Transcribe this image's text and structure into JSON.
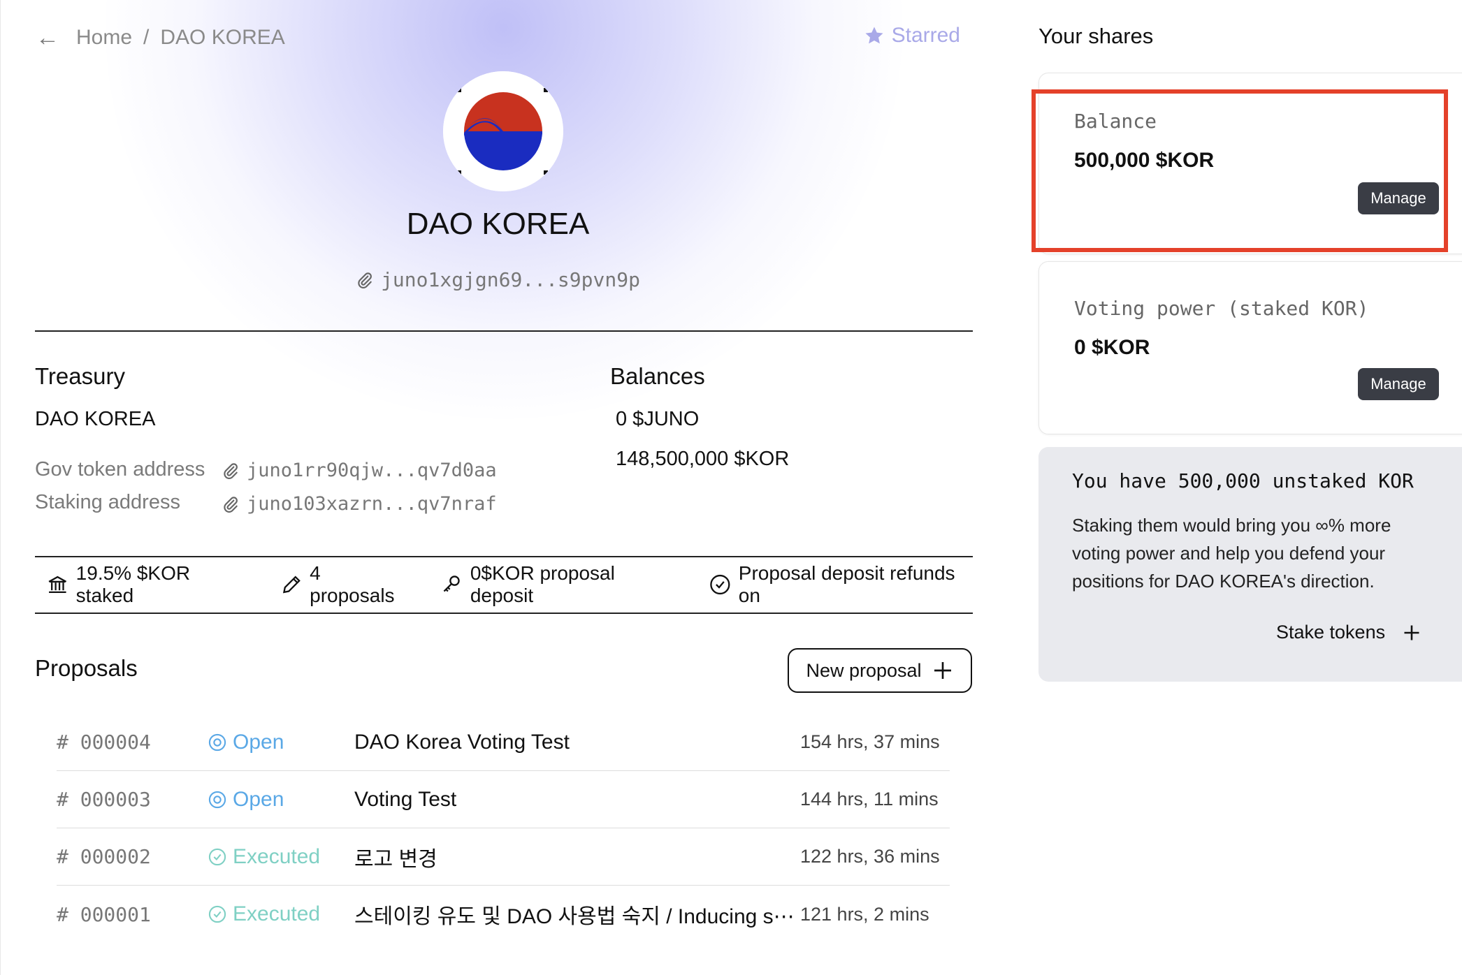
{
  "breadcrumb": {
    "home": "Home",
    "separator": "/",
    "current": "DAO KOREA"
  },
  "starred_label": "Starred",
  "dao": {
    "name": "DAO KOREA",
    "address": "juno1xgjgn69...s9pvn9p"
  },
  "treasury": {
    "heading": "Treasury",
    "name": "DAO KOREA",
    "gov_token_label": "Gov token address",
    "gov_token_address": "juno1rr90qjw...qv7d0aa",
    "staking_label": "Staking address",
    "staking_address": "juno103xazrn...qv7nraf"
  },
  "balances": {
    "heading": "Balances",
    "items": [
      "0 $JUNO",
      "148,500,000 $KOR"
    ]
  },
  "stats": {
    "staked": "19.5% $KOR staked",
    "proposals": "4 proposals",
    "deposit": "0$KOR proposal deposit",
    "refunds": "Proposal deposit refunds on"
  },
  "proposals": {
    "heading": "Proposals",
    "new_button": "New proposal",
    "rows": [
      {
        "id": "# 000004",
        "status": "Open",
        "title": "DAO Korea Voting Test",
        "time": "154 hrs, 37 mins"
      },
      {
        "id": "# 000003",
        "status": "Open",
        "title": "Voting Test",
        "time": "144 hrs, 11 mins"
      },
      {
        "id": "# 000002",
        "status": "Executed",
        "title": "로고 변경",
        "time": "122 hrs, 36 mins"
      },
      {
        "id": "# 000001",
        "status": "Executed",
        "title": "스테이킹 유도 및 DAO 사용법 숙지 / Inducing s⋯",
        "time": "121 hrs, 2 mins"
      }
    ]
  },
  "shares": {
    "title": "Your shares",
    "balance_label": "Balance",
    "balance_value": "500,000 $KOR",
    "voting_label": "Voting power (staked KOR)",
    "voting_value": "0 $KOR",
    "manage_label": "Manage"
  },
  "stake_box": {
    "heading": "You have 500,000 unstaked KOR",
    "body": "Staking them would bring you ∞% more voting power and help you defend your positions for DAO KOREA's direction.",
    "action": "Stake tokens"
  },
  "colors": {
    "accent": "#a9a9e8",
    "open": "#5aa8e6",
    "executed": "#7fd0c4",
    "highlight": "#e4412a",
    "manage_bg": "#3a3d45"
  }
}
